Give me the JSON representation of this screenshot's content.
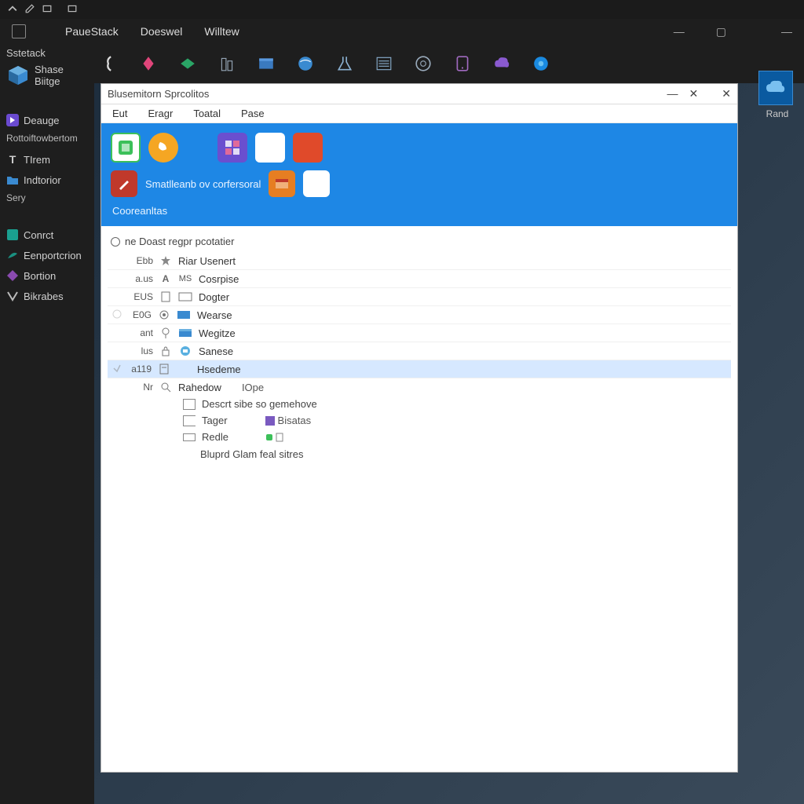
{
  "topbar": {},
  "menubar": {
    "items": [
      "PaueStack",
      "Doeswel",
      "Willtew"
    ]
  },
  "iconbar": {
    "count": 12
  },
  "sidebar": {
    "top_label": "Sstetack",
    "badge_line1": "Shase",
    "badge_line2": "Biitge",
    "items": [
      {
        "label": "Deauge",
        "icon": "violet"
      },
      {
        "sublabel": "Rottoiftowbertom"
      },
      {
        "label": "TIrem",
        "icon": "text-t"
      },
      {
        "label": "Indtorior",
        "icon": "folder-blue"
      },
      {
        "sublabel": "Sery"
      },
      {
        "label": "Conrct",
        "icon": "teal-box"
      },
      {
        "label": "Eenportcrion",
        "icon": "teal-wing"
      },
      {
        "label": "Bortion",
        "icon": "purple-diamond"
      },
      {
        "label": "Bikrabes",
        "icon": "grey-v"
      }
    ]
  },
  "right_col": {
    "label": "Rand"
  },
  "window": {
    "title": "Blusemitorn Sprcolitos",
    "menu": [
      "Eut",
      "Eragr",
      "Toatal",
      "Pase"
    ],
    "blue_row2_text": "Smatlleanb ov corfersoral",
    "blue_footer": "Cooreanltas",
    "list_header": "ne Doast regpr pcotatier",
    "rows": [
      {
        "badge": "Ebb",
        "icon": "star",
        "label": "Riar Usenert"
      },
      {
        "badge": "a.us",
        "icon": "A",
        "icon2": "MS",
        "label": "Cosrpise"
      },
      {
        "badge": "EUS",
        "icon": "doc",
        "icon2": "rect",
        "label": "Dogter"
      },
      {
        "badge": "E0G",
        "icon": "gear",
        "icon2": "blue-rect",
        "label": "Wearse",
        "gutter": true
      },
      {
        "badge": "ant",
        "icon": "pin",
        "icon2": "blue-win",
        "label": "Wegitze"
      },
      {
        "badge": "lus",
        "icon": "lock",
        "icon2": "blue-bot",
        "label": "Sanese"
      },
      {
        "badge": "a119",
        "icon": "doc2",
        "label": "Hsedeme",
        "selected": true,
        "gutter": true
      },
      {
        "badge": "Nr",
        "icon": "mag",
        "label": "Rahedow",
        "label2": "IOpe"
      }
    ],
    "sub_rows": [
      {
        "icon": "rect",
        "label": "Descrt sibe so gemehove"
      },
      {
        "icon": "rect-open",
        "label": "Tager",
        "badge": "Bisatas",
        "badge_icon": "purple-sq"
      },
      {
        "icon": "rect-thin",
        "label": "Redle",
        "badge_icon": "doc",
        "has_dot": true
      }
    ],
    "extra_text": "Bluprd Glam feal sitres"
  }
}
